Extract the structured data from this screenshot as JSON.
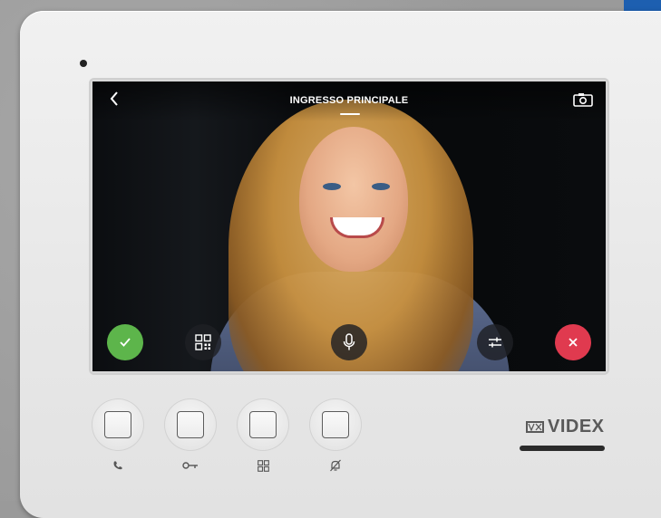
{
  "screen": {
    "title": "INGRESSO PRINCIPALE"
  },
  "icons": {
    "back": "chevron-left-icon",
    "snapshot": "camera-icon",
    "accept": "check-icon",
    "grid": "grid-icon",
    "mic": "microphone-icon",
    "settings": "sliders-icon",
    "reject": "close-icon"
  },
  "hardware_buttons": [
    {
      "icon": "phone-icon"
    },
    {
      "icon": "key-icon"
    },
    {
      "icon": "grid-icon"
    },
    {
      "icon": "mute-icon"
    }
  ],
  "brand": {
    "name": "VIDEX"
  },
  "colors": {
    "accept": "#5db54b",
    "reject": "#e03a4f",
    "overlay_button": "#1e2024"
  }
}
